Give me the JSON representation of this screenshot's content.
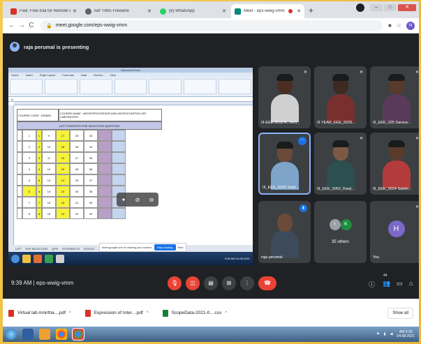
{
  "browser": {
    "tabs": [
      {
        "label": "Fwd: Free trail for Remote Labo",
        "favicon_color": "#d93025"
      },
      {
        "label": "net\"TIMS Freewire",
        "favicon_color": "#5f6368"
      },
      {
        "label": "(8) WhatsApp",
        "favicon_color": "#25d366"
      },
      {
        "label": "Meet - eps-wwig-vmm",
        "favicon_color": "#00897b"
      }
    ],
    "url": "meet.google.com/eps-wwig-vmm",
    "profile_initial": "N"
  },
  "meet": {
    "presenter_label": "raja perumal is presenting",
    "time": "9:39 AM",
    "code": "eps-wwig-vmm",
    "others_count_label": "35 others",
    "others_initials": [
      "I",
      "K"
    ],
    "you_label": "You",
    "you_initial": "H",
    "raise_count": "44",
    "participants": [
      {
        "name": "III-EEE-5018 A...nich...",
        "shirt": "#d0d0d0"
      },
      {
        "name": "III YEAR_EEE_5025...",
        "shirt": "#7a2f2f"
      },
      {
        "name": "III_EEE_025 Sarava...",
        "shirt": "#5a3a5a"
      },
      {
        "name": "III_EEE_5026 Sabh...",
        "shirt": "#7ea4c9"
      },
      {
        "name": "III_EEE_5052_Ranji...",
        "shirt": "#2c4f4f"
      },
      {
        "name": "III_EEE_5024 Sakthi...",
        "shirt": "#b33b3b"
      },
      {
        "name": "raja perumal",
        "shirt": "#3c4a5a"
      }
    ]
  },
  "excel": {
    "title": "Microsoft Excel",
    "menu": [
      "Home",
      "Insert",
      "Page Layout",
      "Formulas",
      "Data",
      "Review",
      "View"
    ],
    "course_code": "COURSE CODE : EE8691",
    "course_name": "COURSE NAME : MICROPROCESSOR AND MICROCONTROLLER LABORATORY",
    "list_title": "LIST STUDENTS FOR SELECTION QUESTION",
    "rows": [
      [
        "1",
        "1",
        "9",
        "17",
        "25",
        "33"
      ],
      [
        "2",
        "2",
        "10",
        "18",
        "26",
        "34"
      ],
      [
        "3",
        "3",
        "11",
        "19",
        "27",
        "35"
      ],
      [
        "4",
        "4",
        "12",
        "20",
        "28",
        "36"
      ],
      [
        "5",
        "5",
        "13",
        "21",
        "29",
        "37"
      ],
      [
        "6",
        "6",
        "14",
        "22",
        "30",
        "38"
      ],
      [
        "7",
        "7",
        "15",
        "23",
        "31",
        "39"
      ],
      [
        "8",
        "8",
        "16",
        "24",
        "32",
        "40"
      ]
    ],
    "sheet_tabs": [
      "LIST",
      "EXP SELECTION",
      "QPR",
      "STOPWATCH",
      "STATUS"
    ],
    "sharing_text": "meet.google.com is sharing your screen.",
    "stop_sharing": "Stop sharing",
    "hide": "Hide",
    "clock": "9:39 AM 04-08-2021"
  },
  "downloads": [
    {
      "name": "Virtual lab Amirtha....pdf",
      "type": "pdf"
    },
    {
      "name": "Expression of Inter....pdf",
      "type": "pdf"
    },
    {
      "name": "ScopeData-2021-0....csv",
      "type": "csv"
    }
  ],
  "show_all": "Show all",
  "taskbar": {
    "clock_time": "AM 9:39",
    "clock_date": "04-08-2021",
    "icons": [
      "start",
      "explorer",
      "media",
      "chrome-other",
      "chrome"
    ]
  },
  "colors": {
    "meet_bg": "#202124",
    "end_call": "#ea4335",
    "accent": "#1a73e8"
  }
}
